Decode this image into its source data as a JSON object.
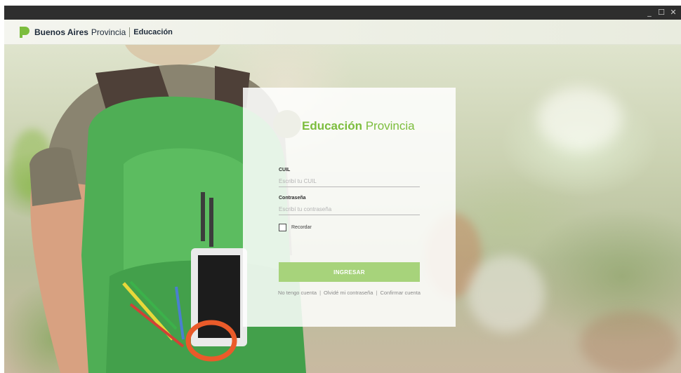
{
  "window": {
    "controls": {
      "minimize": "_",
      "maximize": "☐",
      "close": "✕"
    }
  },
  "header": {
    "brand_strong": "Buenos Aires",
    "brand_light": "Provincia",
    "brand_section": "Educación",
    "logo_color": "#7cbd3d"
  },
  "login": {
    "title_strong": "Educación",
    "title_light": "Provincia",
    "cuil": {
      "label": "CUIL",
      "placeholder": "Escribí tu CUIL",
      "value": ""
    },
    "password": {
      "label": "Contraseña",
      "placeholder": "Escribí tu contraseña",
      "value": ""
    },
    "remember_label": "Recordar",
    "remember_checked": false,
    "submit_label": "INGRESAR",
    "links": {
      "no_account": "No tengo cuenta",
      "forgot_password": "Olvidé mi contraseña",
      "confirm_account": "Confirmar cuenta"
    },
    "links_separator": "|",
    "accent_color": "#7cbd3d",
    "button_color": "#a7d37b"
  }
}
